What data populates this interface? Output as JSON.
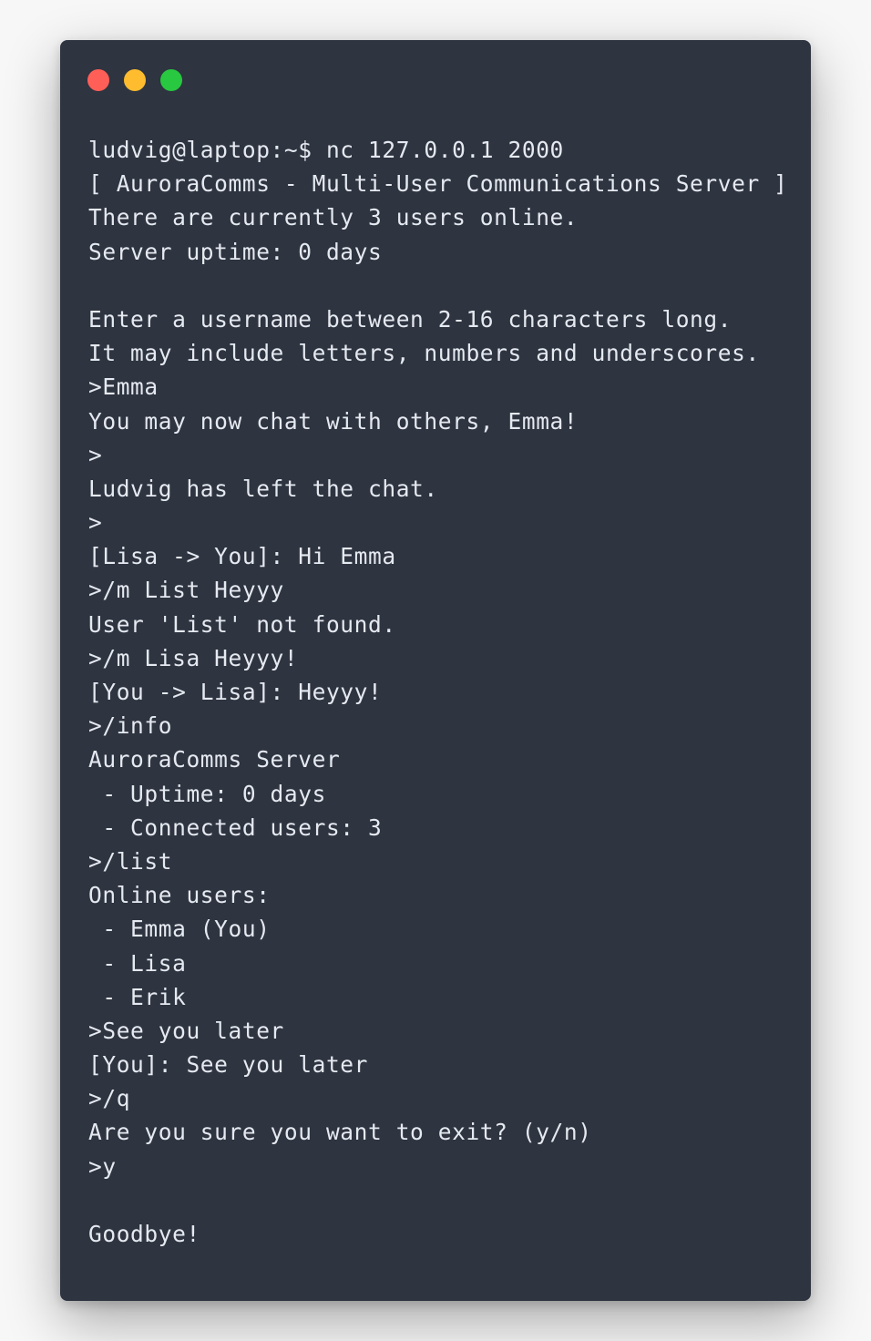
{
  "window": {
    "controls": {
      "close_color": "#ff5f57",
      "minimize_color": "#febc2e",
      "maximize_color": "#28c840"
    },
    "background": "#2e3440",
    "foreground": "#e5e9f0"
  },
  "terminal": {
    "lines": [
      "ludvig@laptop:~$ nc 127.0.0.1 2000",
      "[ AuroraComms - Multi-User Communications Server ]",
      "There are currently 3 users online.",
      "Server uptime: 0 days",
      "",
      "Enter a username between 2-16 characters long.",
      "It may include letters, numbers and underscores.",
      ">Emma",
      "You may now chat with others, Emma!",
      ">",
      "Ludvig has left the chat.",
      ">",
      "[Lisa -> You]: Hi Emma",
      ">/m List Heyyy",
      "User 'List' not found.",
      ">/m Lisa Heyyy!",
      "[You -> Lisa]: Heyyy!",
      ">/info",
      "AuroraComms Server",
      " - Uptime: 0 days",
      " - Connected users: 3",
      ">/list",
      "Online users:",
      " - Emma (You)",
      " - Lisa",
      " - Erik",
      ">See you later",
      "[You]: See you later",
      ">/q",
      "Are you sure you want to exit? (y/n)",
      ">y",
      "",
      "Goodbye!"
    ]
  }
}
